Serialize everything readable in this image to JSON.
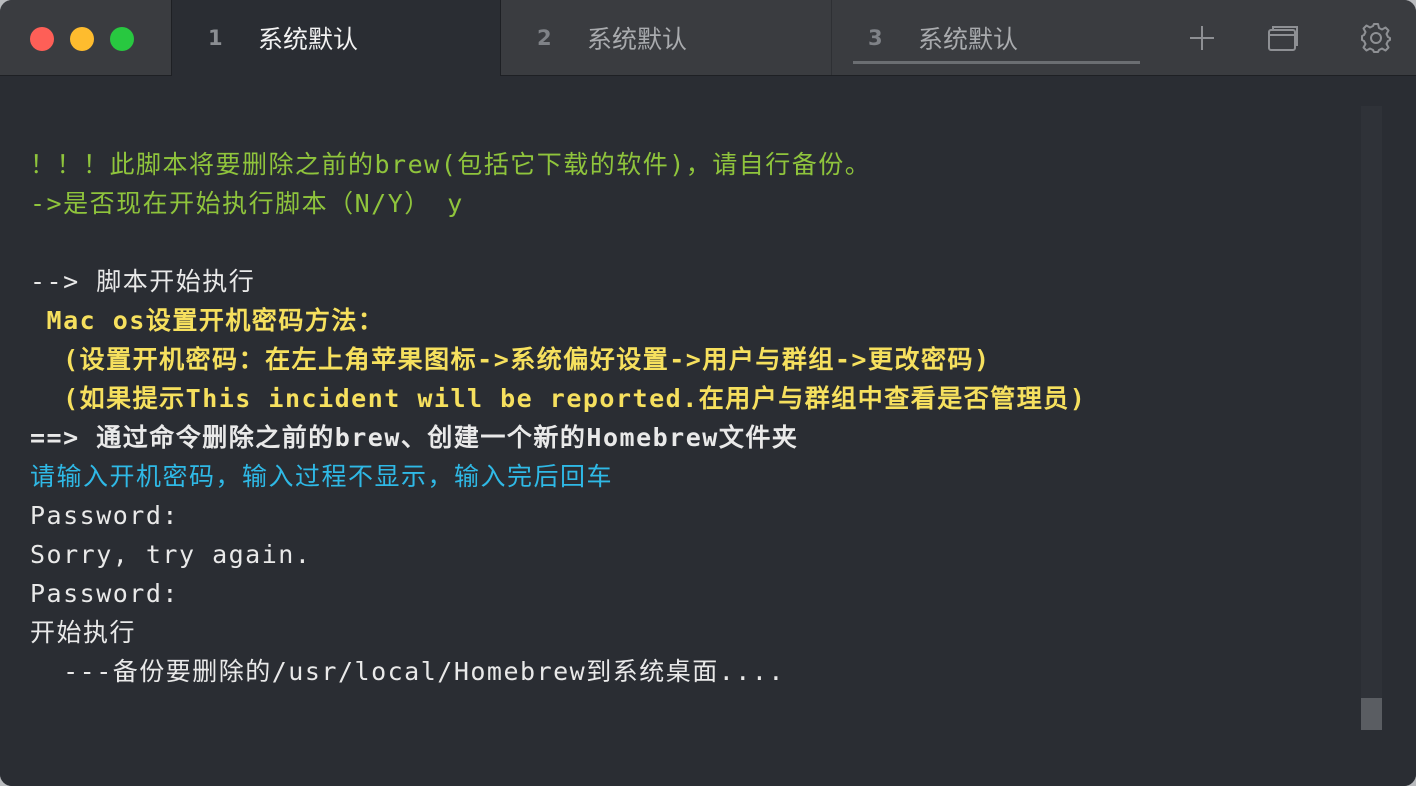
{
  "window": {
    "colors": {
      "close": "#fe5f57",
      "minimize": "#febc2e",
      "maximize": "#28c840",
      "background": "#2a2d33",
      "titlebar": "#3a3c40"
    }
  },
  "tabs": [
    {
      "number": "1",
      "label": "系统默认",
      "active": true
    },
    {
      "number": "2",
      "label": "系统默认",
      "active": false
    },
    {
      "number": "3",
      "label": "系统默认",
      "active": false
    }
  ],
  "toolbar": {
    "icons": [
      "plus-icon",
      "tab-overview-icon",
      "gear-icon"
    ]
  },
  "terminal": {
    "colors": {
      "green": "#8fc43c",
      "white": "#e9e9e9",
      "yellow": "#f6e05e",
      "cyan": "#2fb9e6"
    },
    "lines": [
      "！！！此脚本将要删除之前的brew(包括它下载的软件)，请自行备份。",
      "->是否现在开始执行脚本（N/Y） y",
      "",
      "--> 脚本开始执行",
      " Mac os设置开机密码方法：",
      "  (设置开机密码：在左上角苹果图标->系统偏好设置->用户与群组->更改密码)",
      "  (如果提示This incident will be reported.在用户与群组中查看是否管理员)",
      "==> 通过命令删除之前的brew、创建一个新的Homebrew文件夹",
      "请输入开机密码，输入过程不显示，输入完后回车",
      "Password:",
      "Sorry, try again.",
      "Password:",
      "开始执行",
      "  ---备份要删除的/usr/local/Homebrew到系统桌面...."
    ]
  }
}
